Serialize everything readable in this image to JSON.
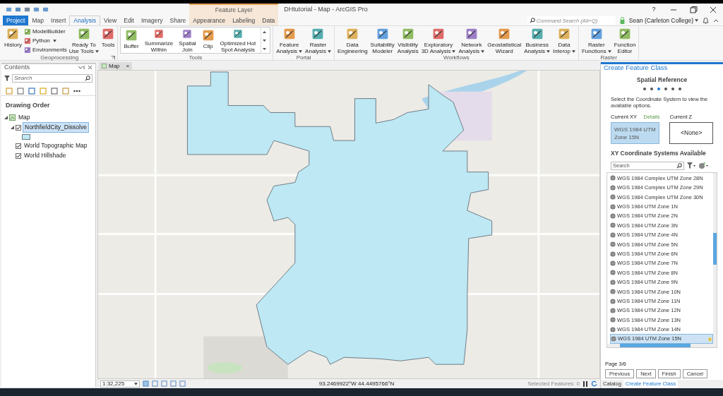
{
  "title_bar": {
    "title": "DHtutorial - Map - ArcGIS Pro",
    "context_header": "Feature Layer",
    "help": "?"
  },
  "tabs": [
    {
      "label": "Project",
      "kind": "backstage",
      "selected": false
    },
    {
      "label": "Map",
      "kind": "normal",
      "selected": false
    },
    {
      "label": "Insert",
      "kind": "normal",
      "selected": false
    },
    {
      "label": "Analysis",
      "kind": "normal",
      "selected": true
    },
    {
      "label": "View",
      "kind": "normal",
      "selected": false
    },
    {
      "label": "Edit",
      "kind": "normal",
      "selected": false
    },
    {
      "label": "Imagery",
      "kind": "normal",
      "selected": false
    },
    {
      "label": "Share",
      "kind": "normal",
      "selected": false
    },
    {
      "label": "Appearance",
      "kind": "contextual",
      "selected": false
    },
    {
      "label": "Labeling",
      "kind": "contextual",
      "selected": false
    },
    {
      "label": "Data",
      "kind": "contextual",
      "selected": false
    }
  ],
  "command_search": {
    "placeholder": "Command Search (Alt+Q)"
  },
  "user": {
    "name": "Sean (Carleton College)"
  },
  "ribbon_groups": [
    {
      "label": "Geoprocessing",
      "launcher": true,
      "items": [
        {
          "kind": "large",
          "lines": [
            "History"
          ],
          "dropdown": false
        },
        {
          "kind": "stack",
          "buttons": [
            {
              "label": "ModelBuilder",
              "dropdown": false
            },
            {
              "label": "Python",
              "dropdown": true
            },
            {
              "label": "Environments",
              "dropdown": false
            }
          ]
        },
        {
          "kind": "large",
          "lines": [
            "Ready To",
            "Use Tools"
          ],
          "dropdown": true
        },
        {
          "kind": "large",
          "lines": [
            "Tools"
          ],
          "dropdown": false
        }
      ]
    },
    {
      "label": "Tools",
      "launcher": false,
      "items": [
        {
          "kind": "gallery",
          "buttons": [
            {
              "lines": [
                "Buffer"
              ]
            },
            {
              "lines": [
                "Summarize",
                "Within"
              ]
            },
            {
              "lines": [
                "Spatial",
                "Join"
              ]
            },
            {
              "lines": [
                "Clip"
              ]
            },
            {
              "lines": [
                "Optimized Hot",
                "Spot Analysis"
              ]
            }
          ]
        }
      ]
    },
    {
      "label": "Portal",
      "launcher": false,
      "items": [
        {
          "kind": "large",
          "lines": [
            "Feature",
            "Analysis"
          ],
          "dropdown": true
        },
        {
          "kind": "large",
          "lines": [
            "Raster",
            "Analysis"
          ],
          "dropdown": true
        }
      ]
    },
    {
      "label": "Workflows",
      "launcher": false,
      "items": [
        {
          "kind": "large",
          "lines": [
            "Data",
            "Engineering"
          ],
          "dropdown": false
        },
        {
          "kind": "large",
          "lines": [
            "Suitability",
            "Modeler"
          ],
          "dropdown": false
        },
        {
          "kind": "large",
          "lines": [
            "Visibility",
            "Analysis"
          ],
          "dropdown": false
        },
        {
          "kind": "large",
          "lines": [
            "Exploratory",
            "3D Analysis"
          ],
          "dropdown": true
        },
        {
          "kind": "large",
          "lines": [
            "Network",
            "Analysis"
          ],
          "dropdown": true
        },
        {
          "kind": "large",
          "lines": [
            "Geostatistical",
            "Wizard"
          ],
          "dropdown": false
        },
        {
          "kind": "large",
          "lines": [
            "Business",
            "Analysis"
          ],
          "dropdown": true
        },
        {
          "kind": "large",
          "lines": [
            "Data",
            "Interop"
          ],
          "dropdown": true
        }
      ]
    },
    {
      "label": "Raster",
      "launcher": false,
      "items": [
        {
          "kind": "large",
          "lines": [
            "Raster",
            "Functions"
          ],
          "dropdown": true
        },
        {
          "kind": "large",
          "lines": [
            "Function",
            "Editor"
          ],
          "dropdown": false
        }
      ]
    }
  ],
  "contents": {
    "title": "Contents",
    "search": {
      "placeholder": "Search"
    },
    "heading": "Drawing Order",
    "tree": [
      {
        "label": "Map",
        "kind": "map",
        "expanded": true,
        "children": [
          {
            "label": "NorthfieldCity_Dissolve",
            "kind": "layer",
            "checked": true,
            "selected": true,
            "expanded": true,
            "symbol_swatch": true
          },
          {
            "label": "World Topographic Map",
            "kind": "layer",
            "checked": true,
            "selected": false
          },
          {
            "label": "World Hillshade",
            "kind": "layer",
            "checked": true,
            "selected": false
          }
        ]
      }
    ]
  },
  "map_view": {
    "tab": {
      "label": "Map",
      "close": "×"
    },
    "status_bar": {
      "scale": "1:32,225",
      "coordinates": "93.2469922°W 44.4495766°N",
      "selected_features": "Selected Features: 0"
    }
  },
  "create_feature_class": {
    "title": "Create Feature Class",
    "step_title": "Spatial Reference",
    "steps": [
      {
        "selected": false
      },
      {
        "selected": false
      },
      {
        "selected": true
      },
      {
        "selected": false
      },
      {
        "selected": false
      },
      {
        "selected": false
      }
    ],
    "instructions": "Select the Coordinate System to view the available options.",
    "current_xy": {
      "label": "Current XY",
      "details_link": "Details",
      "value": "WGS 1984 UTM Zone 15N"
    },
    "current_z": {
      "label": "Current Z",
      "value": "<None>"
    },
    "available_heading": "XY Coordinate Systems Available",
    "search": {
      "placeholder": "Search"
    },
    "systems": [
      {
        "label": "WGS 1984 Complex UTM Zone 28N",
        "selected": false,
        "favorite": false
      },
      {
        "label": "WGS 1984 Complex UTM Zone 29N",
        "selected": false,
        "favorite": false
      },
      {
        "label": "WGS 1984 Complex UTM Zone 30N",
        "selected": false,
        "favorite": false
      },
      {
        "label": "WGS 1984 UTM Zone  1N",
        "selected": false,
        "favorite": false
      },
      {
        "label": "WGS 1984 UTM Zone  2N",
        "selected": false,
        "favorite": false
      },
      {
        "label": "WGS 1984 UTM Zone  3N",
        "selected": false,
        "favorite": false
      },
      {
        "label": "WGS 1984 UTM Zone  4N",
        "selected": false,
        "favorite": false
      },
      {
        "label": "WGS 1984 UTM Zone  5N",
        "selected": false,
        "favorite": false
      },
      {
        "label": "WGS 1984 UTM Zone  6N",
        "selected": false,
        "favorite": false
      },
      {
        "label": "WGS 1984 UTM Zone  7N",
        "selected": false,
        "favorite": false
      },
      {
        "label": "WGS 1984 UTM Zone  8N",
        "selected": false,
        "favorite": false
      },
      {
        "label": "WGS 1984 UTM Zone  9N",
        "selected": false,
        "favorite": false
      },
      {
        "label": "WGS 1984 UTM Zone 10N",
        "selected": false,
        "favorite": false
      },
      {
        "label": "WGS 1984 UTM Zone 11N",
        "selected": false,
        "favorite": false
      },
      {
        "label": "WGS 1984 UTM Zone 12N",
        "selected": false,
        "favorite": false
      },
      {
        "label": "WGS 1984 UTM Zone 13N",
        "selected": false,
        "favorite": false
      },
      {
        "label": "WGS 1984 UTM Zone 14N",
        "selected": false,
        "favorite": false
      },
      {
        "label": "WGS 1984 UTM Zone 15N",
        "selected": true,
        "favorite": true
      }
    ],
    "page": "Page 3/6",
    "buttons": [
      "Previous",
      "Next",
      "Finish",
      "Cancel"
    ],
    "pane_tabs": [
      {
        "label": "Catalog",
        "selected": false
      },
      {
        "label": "Create Feature Class",
        "selected": true
      }
    ]
  }
}
